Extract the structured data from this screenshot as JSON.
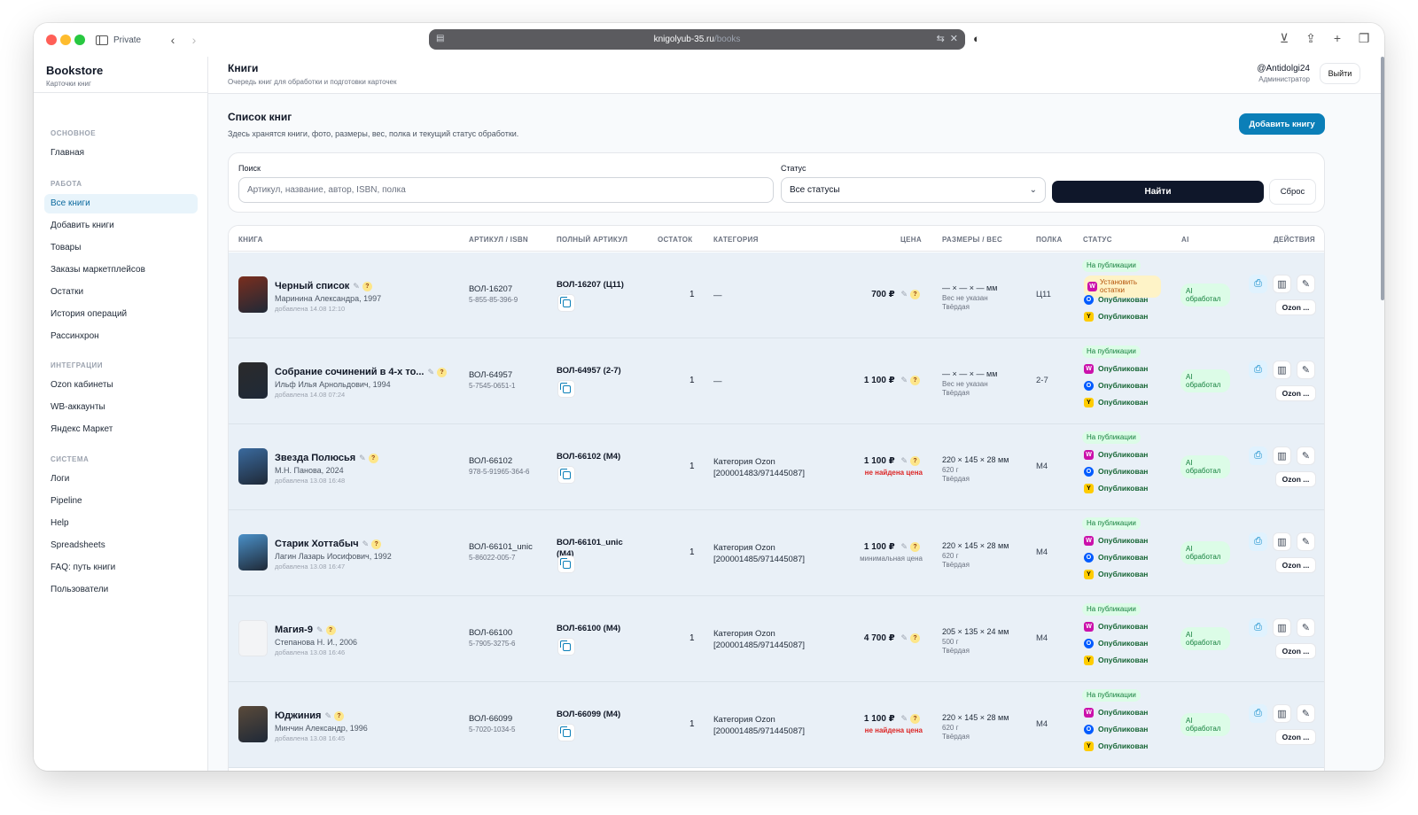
{
  "browser": {
    "private_label": "Private",
    "url_host": "knigolyub-35.ru",
    "url_path": "/books"
  },
  "sidebar": {
    "title": "Bookstore",
    "subtitle": "Карточки книг",
    "sections": [
      {
        "label": "ОСНОВНОЕ",
        "items": [
          "Главная"
        ]
      },
      {
        "label": "РАБОТА",
        "items": [
          "Все книги",
          "Добавить книги",
          "Товары",
          "Заказы маркетплейсов",
          "Остатки",
          "История операций",
          "Рассинхрон"
        ]
      },
      {
        "label": "ИНТЕГРАЦИИ",
        "items": [
          "Ozon кабинеты",
          "WB-аккаунты",
          "Яндекс Маркет"
        ]
      },
      {
        "label": "СИСТЕМА",
        "items": [
          "Логи",
          "Pipeline",
          "Help",
          "Spreadsheets",
          "FAQ: путь книги",
          "Пользователи"
        ]
      }
    ],
    "active_item": "Все книги"
  },
  "header": {
    "title": "Книги",
    "subtitle": "Очередь книг для обработки и подготовки карточек",
    "user": "@Antidolgi24",
    "role": "Администратор",
    "logout": "Выйти"
  },
  "section": {
    "title": "Список книг",
    "subtitle": "Здесь хранятся книги, фото, размеры, вес, полка и текущий статус обработки.",
    "add_button": "Добавить книгу"
  },
  "filters": {
    "search_label": "Поиск",
    "search_placeholder": "Артикул, название, автор, ISBN, полка",
    "status_label": "Статус",
    "status_value": "Все статусы",
    "find": "Найти",
    "reset": "Сброс"
  },
  "table": {
    "headers": [
      "КНИГА",
      "АРТИКУЛ / ISBN",
      "ПОЛНЫЙ АРТИКУЛ",
      "ОСТАТОК",
      "КАТЕГОРИЯ",
      "ЦЕНА",
      "РАЗМЕРЫ / ВЕС",
      "ПОЛКА",
      "СТАТУС",
      "AI",
      "ДЕЙСТВИЯ"
    ],
    "status_pub": "На публикации",
    "published": "Опубликован",
    "ai_label": "AI обработал",
    "ozon_btn": "Ozon ...",
    "rows": [
      {
        "title": "Черный список",
        "author": "Маринина Александра, 1997",
        "added": "добавлена 14.08 12:10",
        "sku": "ВОЛ-16207",
        "isbn": "5-855-85-396-9",
        "full": "ВОЛ-16207 (Ц11)",
        "stock": "1",
        "category": "—",
        "price": "700 ₽",
        "price_note": "",
        "dims": "— × — × — мм",
        "weight": "Вес не указан",
        "binding": "Твёрдая",
        "shelf": "Ц11",
        "wb_status": "Установить остатки",
        "cover_color": "#7a2e1e"
      },
      {
        "title": "Собрание сочинений в 4-х то...",
        "author": "Ильф Илья Арнольдович, 1994",
        "added": "добавлена 14.08 07:24",
        "sku": "ВОЛ-64957",
        "isbn": "5-7545-0651-1",
        "full": "ВОЛ-64957 (2-7)",
        "stock": "1",
        "category": "—",
        "price": "1 100 ₽",
        "price_note": "",
        "dims": "— × — × — мм",
        "weight": "Вес не указан",
        "binding": "Твёрдая",
        "shelf": "2-7",
        "wb_status": "",
        "cover_color": "#2b2b2b"
      },
      {
        "title": "Звезда Полюсья",
        "author": "М.Н. Панова, 2024",
        "added": "добавлена 13.08 16:48",
        "sku": "ВОЛ-66102",
        "isbn": "978-5-91965-364-6",
        "full": "ВОЛ-66102 (М4)",
        "stock": "1",
        "category": "Категория Ozon [200001483/971445087]",
        "price": "1 100 ₽",
        "price_note": "не найдена цена",
        "dims": "220 × 145 × 28 мм",
        "weight": "620 г",
        "binding": "Твёрдая",
        "shelf": "М4",
        "wb_status": "",
        "cover_color": "#3a6a9e"
      },
      {
        "title": "Старик Хоттабыч",
        "author": "Лагин Лазарь Иосифович, 1992",
        "added": "добавлена 13.08 16:47",
        "sku": "ВОЛ-66101_unic",
        "isbn": "5-86022-005-7",
        "full": "ВОЛ-66101_unic (М4)",
        "stock": "1",
        "category": "Категория Ozon [200001485/971445087]",
        "price": "1 100 ₽",
        "price_note": "минимальная цена",
        "dims": "220 × 145 × 28 мм",
        "weight": "620 г",
        "binding": "Твёрдая",
        "shelf": "М4",
        "wb_status": "",
        "cover_color": "#4a90c8"
      },
      {
        "title": "Магия-9",
        "author": "Степанова Н. И., 2006",
        "added": "добавлена 13.08 16:46",
        "sku": "ВОЛ-66100",
        "isbn": "5-7905-3275-6",
        "full": "ВОЛ-66100 (М4)",
        "stock": "1",
        "category": "Категория Ozon [200001485/971445087]",
        "price": "4 700 ₽",
        "price_note": "",
        "dims": "205 × 135 × 24 мм",
        "weight": "500 г",
        "binding": "Твёрдая",
        "shelf": "М4",
        "wb_status": "",
        "cover_color": ""
      },
      {
        "title": "Юджиния",
        "author": "Минчин Александр, 1996",
        "added": "добавлена 13.08 16:45",
        "sku": "ВОЛ-66099",
        "isbn": "5-7020-1034-5",
        "full": "ВОЛ-66099 (М4)",
        "stock": "1",
        "category": "Категория Ozon [200001485/971445087]",
        "price": "1 100 ₽",
        "price_note": "не найдена цена",
        "dims": "220 × 145 × 28 мм",
        "weight": "620 г",
        "binding": "Твёрдая",
        "shelf": "М4",
        "wb_status": "",
        "cover_color": "#5a4a3a"
      }
    ]
  },
  "colors": {
    "accent": "#0b7fb8",
    "dark_button": "#0f172a",
    "row_bg": "#e9f0f7",
    "published_green": "#15803d",
    "warning": "#b45309",
    "error_red": "#dc2626"
  }
}
